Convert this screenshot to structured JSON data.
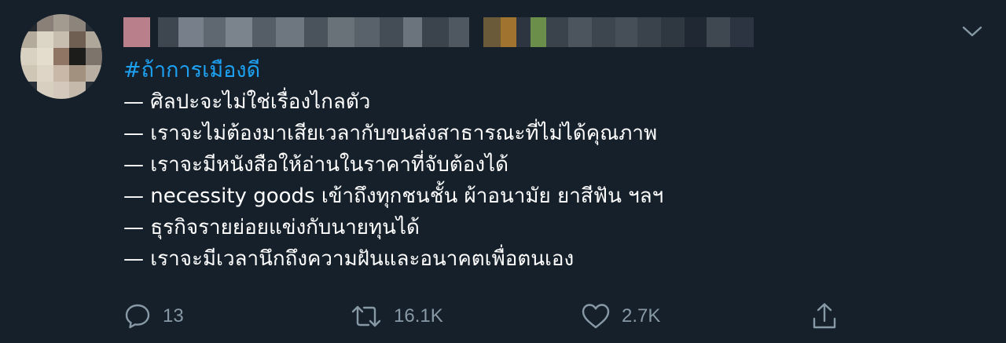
{
  "tweet": {
    "hashtag": "#ถ้าการเมืองดี",
    "lines": [
      "— ศิลปะจะไม่ใช่เรื่องไกลตัว",
      "— เราจะไม่ต้องมาเสียเวลากับขนส่งสาธารณะที่ไม่ได้คุณภาพ",
      "— เราจะมีหนังสือให้อ่านในราคาที่จับต้องได้",
      "— necessity goods เข้าถึงทุกชนชั้น ผ้าอนามัย ยาสีฟัน ฯลฯ",
      "— ธุรกิจรายย่อยแข่งกับนายทุนได้",
      "— เราจะมีเวลานึกถึงความฝันและอนาคตเพื่อตนเอง"
    ]
  },
  "actions": {
    "reply_count": "13",
    "retweet_count": "16.1K",
    "like_count": "2.7K"
  },
  "icons": {
    "reply": "reply-icon",
    "retweet": "retweet-icon",
    "like": "heart-icon",
    "share": "share-icon",
    "menu": "chevron-down-icon"
  },
  "colors": {
    "background": "#15202b",
    "text": "#ffffff",
    "accent": "#1da1f2",
    "muted": "#8899a6"
  }
}
